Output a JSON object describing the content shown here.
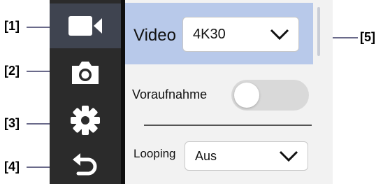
{
  "callouts": [
    "[1]",
    "[2]",
    "[3]",
    "[4]",
    "[5]"
  ],
  "sidebar": {
    "items": [
      {
        "icon": "video-camera-icon",
        "active": true
      },
      {
        "icon": "photo-camera-icon",
        "active": false
      },
      {
        "icon": "gear-icon",
        "active": false
      },
      {
        "icon": "back-arrow-icon",
        "active": false
      }
    ]
  },
  "settings": {
    "video": {
      "label": "Video",
      "value": "4K30"
    },
    "pre_record": {
      "label": "Voraufnahme",
      "enabled": false
    },
    "looping": {
      "label": "Looping",
      "value": "Aus"
    }
  },
  "colors": {
    "sidebar_bg": "#2b2b2b",
    "sidebar_active": "#3f4450",
    "panel_bg": "#f2f2f2",
    "selected_row": "#b8c9ea",
    "toggle_off": "#d9d9d9"
  }
}
